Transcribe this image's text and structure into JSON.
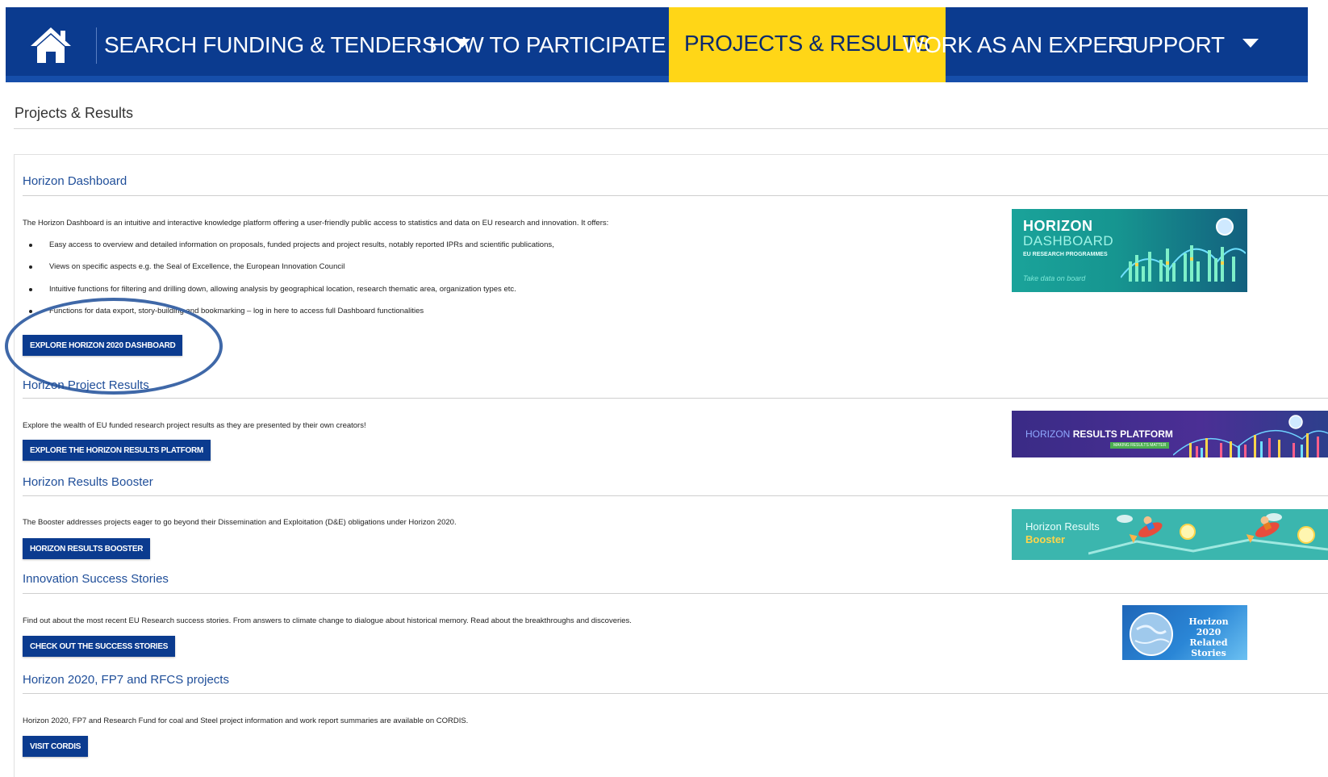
{
  "nav": {
    "home_icon": "home-icon",
    "items": [
      {
        "label": "SEARCH FUNDING & TENDERS",
        "has_dropdown": true
      },
      {
        "label": "HOW TO PARTICIPATE",
        "has_dropdown": true
      },
      {
        "label": "PROJECTS & RESULTS",
        "active": true
      },
      {
        "label": "WORK AS AN EXPERT"
      },
      {
        "label": "SUPPORT",
        "has_dropdown": true
      }
    ],
    "colors": {
      "background": "#0b3b8f",
      "active_background": "#ffd617",
      "active_text": "#0b2a6e"
    }
  },
  "page": {
    "title": "Projects & Results"
  },
  "sections": {
    "dashboard": {
      "title": "Horizon Dashboard",
      "intro": "The Horizon Dashboard is an intuitive and interactive knowledge platform offering a user-friendly public access to statistics and data on EU research and innovation. It offers:",
      "bullets": [
        "Easy access to overview and detailed information on proposals, funded projects and project results, notably reported IPRs and scientific publications,",
        "Views on specific aspects e.g. the Seal of Excellence, the European Innovation Council",
        "Intuitive functions for filtering and drilling down, allowing analysis by geographical location, research thematic area, organization types etc.",
        "Functions for data export, story-building and bookmarking – log in here to access full Dashboard functionalities"
      ],
      "button": "EXPLORE HORIZON 2020 DASHBOARD",
      "banner": {
        "line1": "HORIZON",
        "line2": "DASHBOARD",
        "line3": "EU RESEARCH PROGRAMMES",
        "tagline": "Take data on board"
      }
    },
    "results": {
      "title": "Horizon Project Results",
      "text": "Explore the wealth of EU funded research project results as they are presented by their own creators!",
      "button": "EXPLORE THE HORIZON RESULTS PLATFORM",
      "banner": {
        "word1": "HORIZON",
        "word2": "RESULTS PLATFORM",
        "tagline": "MAKING RESULTS MATTER"
      }
    },
    "booster": {
      "title": "Horizon Results Booster",
      "text": "The Booster addresses projects eager to go beyond their Dissemination and Exploitation (D&E) obligations under Horizon 2020.",
      "button": "HORIZON RESULTS BOOSTER",
      "banner": {
        "line1": "Horizon Results",
        "line2": "Booster"
      }
    },
    "stories": {
      "title": "Innovation Success Stories",
      "text": "Find out about the most recent EU Research success stories. From answers to climate change to dialogue about historical memory. Read about the breakthroughs and discoveries.",
      "button": "CHECK OUT THE SUCCESS STORIES",
      "banner": {
        "line1": "Horizon 2020",
        "line2": "Related",
        "line3": "Stories"
      }
    },
    "cordis": {
      "title": "Horizon 2020, FP7 and RFCS projects",
      "text": "Horizon 2020, FP7 and Research Fund for coal and Steel project information and work report summaries are available on CORDIS.",
      "button": "VISIT CORDIS"
    }
  }
}
